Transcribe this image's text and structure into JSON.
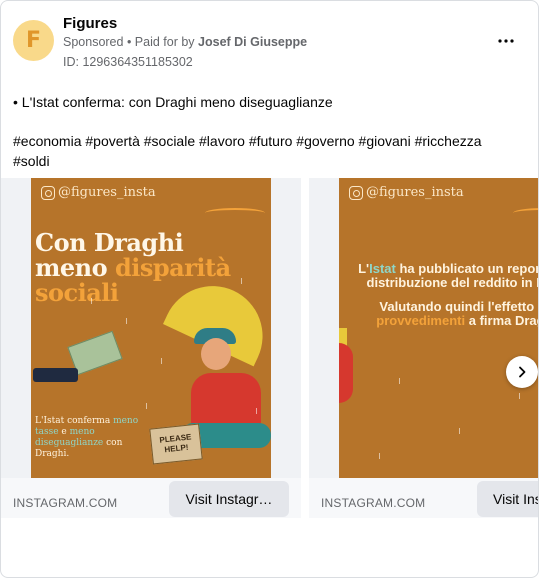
{
  "post": {
    "page_name": "Figures",
    "avatar_letter": "F",
    "sponsored": "Sponsored",
    "paid_prefix": " • Paid for by ",
    "payer": "Josef Di Giuseppe",
    "ad_id": "ID: 1296364351185302",
    "more_icon": "more-dots-icon",
    "body": "• L'Istat conferma: con Draghi meno diseguaglianze",
    "hashtags": "#economia #povertà #sociale #lavoro #futuro #governo #giovani #ricchezza #soldi"
  },
  "carousel": {
    "cards": [
      {
        "ig_handle": "@figures_insta",
        "headline_1": "Con Draghi",
        "headline_2a": "meno ",
        "headline_2b": "disparità",
        "headline_3": "sociali",
        "caption_a": "L'Istat conferma ",
        "caption_b": "meno tasse",
        "caption_c": " e ",
        "caption_d": "meno diseguaglianze",
        "caption_e": " con Draghi.",
        "sign": "PLEASE HELP!",
        "domain": "INSTAGRAM.COM",
        "cta": "Visit Instagr…"
      },
      {
        "ig_handle": "@figures_insta",
        "text_a": "L'",
        "text_b": "Istat",
        "text_c": " ha pubblicato un report sulla distribuzione del reddito in Italia.",
        "text_d": "Valutando quindi l'effetto dei ",
        "text_e": "provvedimenti",
        "text_f": " a firma Draghi.",
        "domain": "INSTAGRAM.COM",
        "cta": "Visit Ins"
      }
    ],
    "next_icon": "chevron-right-icon"
  },
  "colors": {
    "slide_bg": "#b6742a",
    "accent_orange": "#f3a23a",
    "accent_teal": "#8fd6c7",
    "cta_bg": "#e4e6eb"
  }
}
